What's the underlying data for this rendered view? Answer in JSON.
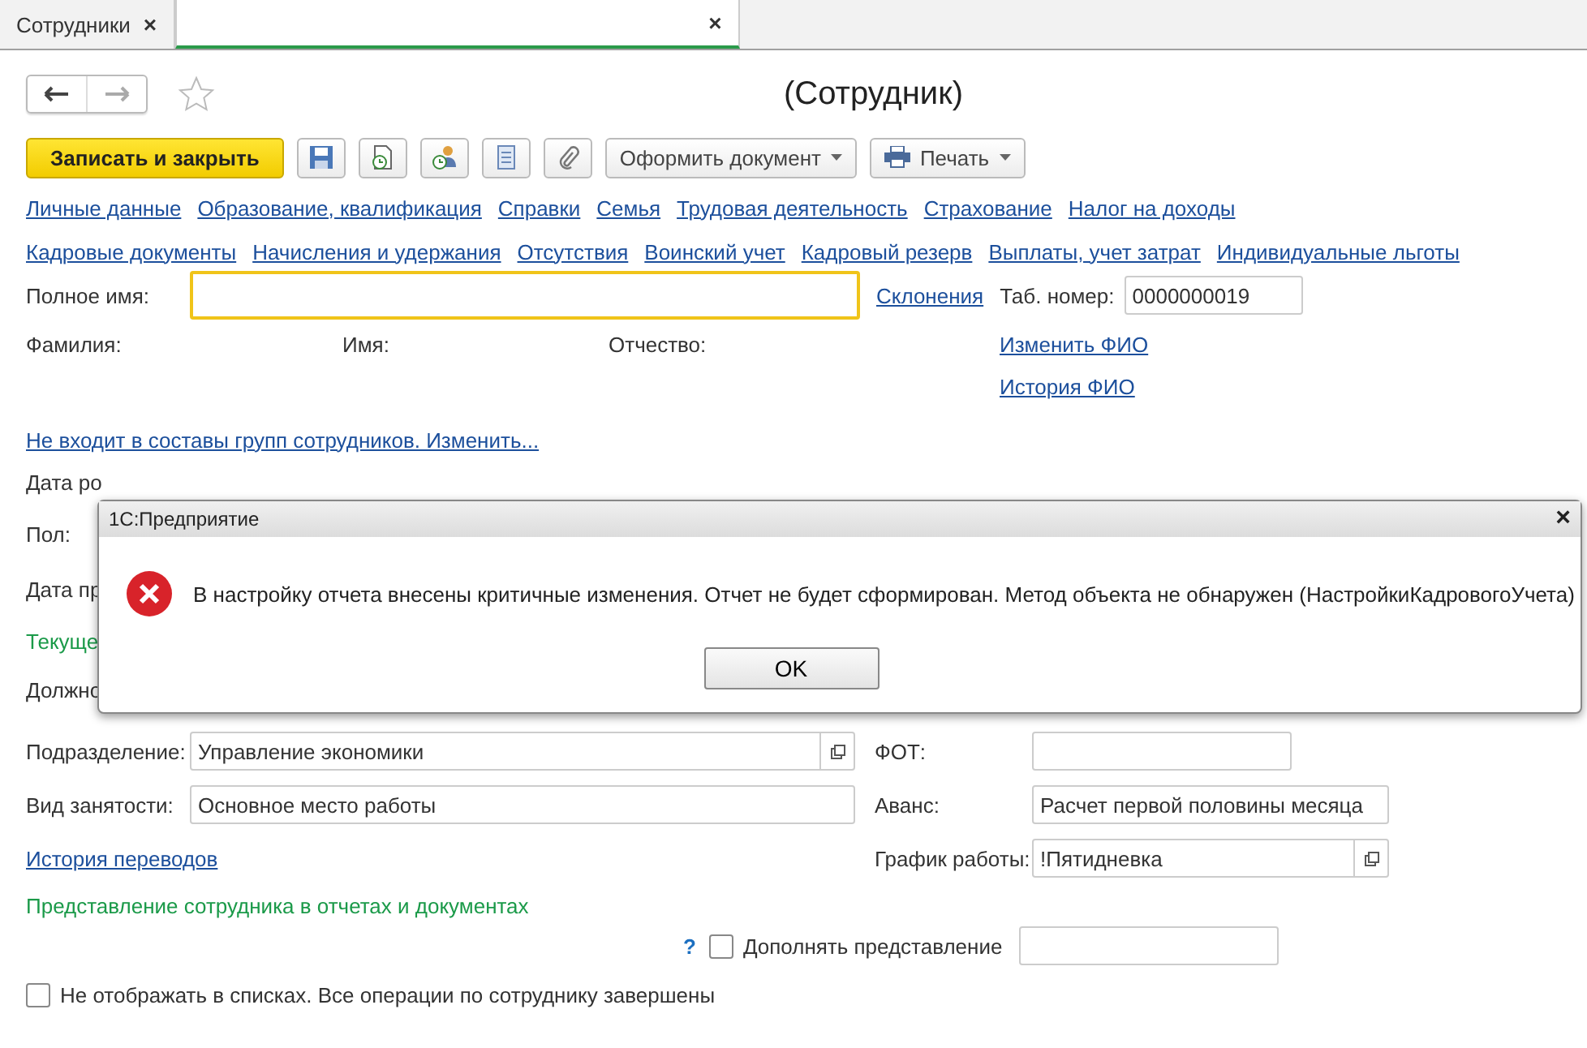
{
  "tabs": [
    {
      "label": "Сотрудники",
      "selected": false,
      "close": "×"
    },
    {
      "selected": true,
      "close": "×"
    }
  ],
  "header": {
    "title": "(Сотрудник)",
    "favorite": false
  },
  "toolbar": [
    {
      "kind": "primary",
      "label": "Записать и закрыть"
    },
    {
      "kind": "icon"
    },
    {
      "kind": "icon"
    },
    {
      "kind": "icon"
    },
    {
      "kind": "icon"
    },
    {
      "kind": "icon"
    },
    {
      "kind": "menu",
      "label": "Оформить документ"
    },
    {
      "kind": "print",
      "label": "Печать"
    }
  ],
  "section_links": [
    [
      "Личные данные",
      "Образование, квалификация",
      "Справки",
      "Семья",
      "Трудовая деятельность",
      "Страхование",
      "Налог на доходы"
    ],
    [
      "Кадровые документы",
      "Начисления и удержания",
      "Отсутствия",
      "Воинский учет",
      "Кадровый резерв",
      "Выплаты, учет затрат",
      "Индивидуальные льготы"
    ]
  ],
  "full_name": {
    "label": "Полное имя:",
    "link": "Склонения",
    "tab_label": "Таб. номер:",
    "tab_value": "0000000019"
  },
  "name_parts": [
    "Фамилия:",
    "Имя:",
    "Отчество:"
  ],
  "name_links": [
    "Изменить ФИО",
    "История ФИО"
  ],
  "groups_link": "Не входит в составы групп сотрудников. Изменить...",
  "covered_labels": [
    {
      "kind": "label",
      "text": "Дата ро"
    },
    {
      "kind": "label",
      "text": "Пол:"
    },
    {
      "kind": "label",
      "text": "Дата пр"
    },
    {
      "kind": "heading",
      "text": "Текуще"
    },
    {
      "kind": "label",
      "text": "Должно"
    }
  ],
  "dialog": {
    "title": "1С:Предприятие",
    "close": "×",
    "message": "В настройку отчета внесены критичные изменения. Отчет не будет сформирован. Метод объекта не обнаружен (НастройкиКадровогоУчета)",
    "button": "OK"
  },
  "department": {
    "label": "Подразделение:",
    "value": "Управление экономики"
  },
  "payroll": {
    "label": "ФОТ:"
  },
  "employment": {
    "label": "Вид занятости:",
    "value": "Основное место работы"
  },
  "advance": {
    "label": "Аванс:",
    "value": "Расчет первой половины месяца"
  },
  "transfers_link": "История переводов",
  "schedule": {
    "label": "График работы:",
    "value": "!Пятидневка"
  },
  "presentation": {
    "heading": "Представление сотрудника в отчетах и документах",
    "help": "?",
    "supplement": {
      "label": "Дополнять представление",
      "checked": false
    }
  },
  "hide_in_lists": {
    "label": "Не отображать в списках. Все операции по сотруднику завершены",
    "checked": false
  }
}
